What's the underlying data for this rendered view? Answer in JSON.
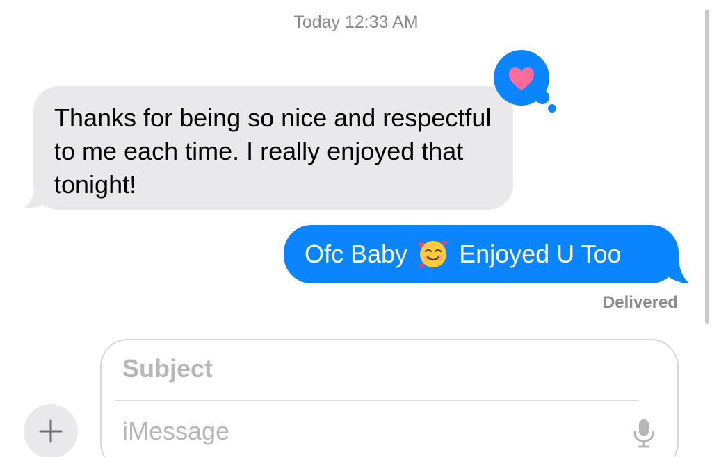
{
  "conversation": {
    "timestamp": "Today 12:33 AM",
    "messages": [
      {
        "direction": "received",
        "text": "Thanks for being so nice and respectful to me each time. I really enjoyed that tonight!",
        "tapback": "heart-icon"
      },
      {
        "direction": "sent",
        "text_before_emoji": "Ofc Baby",
        "emoji": "smiling-face-with-hearts",
        "text_after_emoji": "Enjoyed U Too",
        "status": "Delivered"
      }
    ]
  },
  "compose": {
    "subject_placeholder": "Subject",
    "message_placeholder": "iMessage",
    "plus_button_icon": "plus-icon",
    "mic_icon": "microphone-icon"
  },
  "colors": {
    "sent_bubble": "#0a84ff",
    "received_bubble": "#e9e9eb",
    "tapback_heart": "#ff6b9d"
  }
}
